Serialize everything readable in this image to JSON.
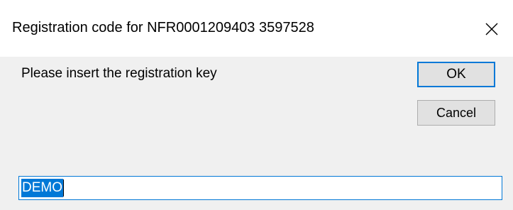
{
  "window": {
    "title": "Registration code for NFR0001209403 3597528",
    "close_icon": "close-icon"
  },
  "prompt": {
    "text": "Please insert the registration key"
  },
  "buttons": {
    "ok_label": "OK",
    "cancel_label": "Cancel"
  },
  "input": {
    "value": "DEMO",
    "selected": true
  },
  "colors": {
    "accent": "#0078d7",
    "dialog_bg": "#f0f0f0",
    "titlebar_bg": "#ffffff",
    "button_bg": "#e1e1e1"
  }
}
